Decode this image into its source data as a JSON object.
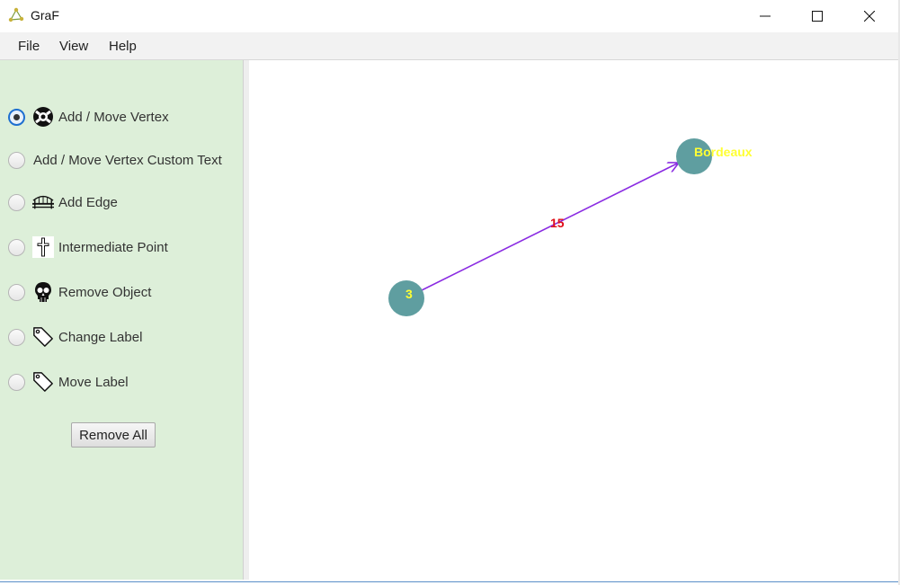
{
  "window": {
    "title": "GraF",
    "app_icon": "graph-app-icon",
    "controls": [
      "minimize-icon",
      "maximize-icon",
      "close-icon"
    ]
  },
  "menu": {
    "file": "File",
    "view": "View",
    "help": "Help"
  },
  "tools": {
    "selected": "add-move-vertex",
    "items": [
      {
        "label": "Add / Move Vertex",
        "icon": "lifebuoy-icon",
        "checked": true
      },
      {
        "label": "Add / Move Vertex Custom Text",
        "icon": "",
        "checked": false
      },
      {
        "label": "Add Edge",
        "icon": "bridge-icon",
        "checked": false
      },
      {
        "label": "Intermediate Point",
        "icon": "cross-icon",
        "checked": false
      },
      {
        "label": "Remove Object",
        "icon": "skull-icon",
        "checked": false
      },
      {
        "label": "Change Label",
        "icon": "tag-icon",
        "checked": false
      },
      {
        "label": "Move Label",
        "icon": "tag-icon",
        "checked": false
      }
    ],
    "remove_all": "Remove All"
  },
  "graph": {
    "vertices": [
      {
        "label": "3"
      },
      {
        "label": "Bordeaux"
      }
    ],
    "edges": [
      {
        "from": "3",
        "to": "Bordeaux",
        "label": "15",
        "directed": true
      }
    ],
    "colors": {
      "vertex_fill": "#5f9ea0",
      "vertex_label": "#ffff33",
      "edge_stroke": "#8a2be2",
      "edge_label": "#e0101a",
      "panel_background": "#ddefd9"
    }
  }
}
